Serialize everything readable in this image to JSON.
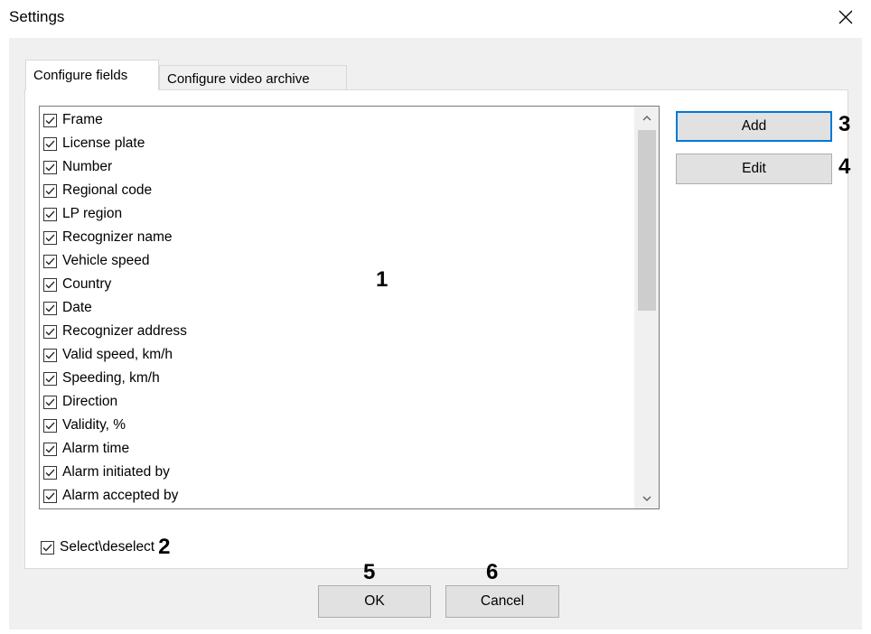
{
  "window": {
    "title": "Settings"
  },
  "tabs": [
    {
      "label": "Configure fields"
    },
    {
      "label": "Configure video archive"
    }
  ],
  "fields": [
    {
      "label": "Frame",
      "checked": true
    },
    {
      "label": "License plate",
      "checked": true
    },
    {
      "label": "Number",
      "checked": true
    },
    {
      "label": "Regional code",
      "checked": true
    },
    {
      "label": "LP region",
      "checked": true
    },
    {
      "label": "Recognizer name",
      "checked": true
    },
    {
      "label": "Vehicle speed",
      "checked": true
    },
    {
      "label": "Country",
      "checked": true
    },
    {
      "label": "Date",
      "checked": true
    },
    {
      "label": "Recognizer address",
      "checked": true
    },
    {
      "label": "Valid speed, km/h",
      "checked": true
    },
    {
      "label": "Speeding, km/h",
      "checked": true
    },
    {
      "label": "Direction",
      "checked": true
    },
    {
      "label": "Validity, %",
      "checked": true
    },
    {
      "label": "Alarm time",
      "checked": true
    },
    {
      "label": "Alarm initiated by",
      "checked": true
    },
    {
      "label": "Alarm accepted by",
      "checked": true
    }
  ],
  "buttons": {
    "add": "Add",
    "edit": "Edit",
    "ok": "OK",
    "cancel": "Cancel"
  },
  "select_all": {
    "label": "Select\\deselect",
    "checked": true
  },
  "annotations": {
    "list": "1",
    "select_all": "2",
    "add": "3",
    "edit": "4",
    "ok": "5",
    "cancel": "6"
  },
  "icons": {
    "close": "close-icon",
    "check": "checkmark-icon",
    "scroll_up": "chevron-up-icon",
    "scroll_down": "chevron-down-icon"
  },
  "colors": {
    "accent": "#0078d7",
    "window_bg": "#f0f0f0",
    "button_bg": "#e1e1e1"
  }
}
